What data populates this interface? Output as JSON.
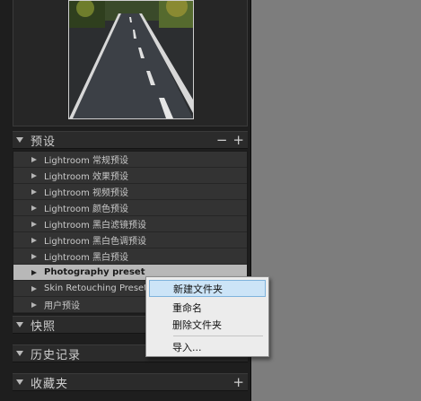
{
  "presets_panel": {
    "title": "预设",
    "minus_label": "−",
    "plus_label": "+",
    "items": [
      {
        "label": "Lightroom 常规预设"
      },
      {
        "label": "Lightroom 效果预设"
      },
      {
        "label": "Lightroom 视频预设"
      },
      {
        "label": "Lightroom 颜色预设"
      },
      {
        "label": "Lightroom 黑白滤镜预设"
      },
      {
        "label": "Lightroom 黑白色调预设"
      },
      {
        "label": "Lightroom 黑白预设"
      },
      {
        "label": "Photography preset",
        "selected": true
      },
      {
        "label": "Skin Retouching Preset"
      },
      {
        "label": "用户预设"
      }
    ]
  },
  "snapshots_panel": {
    "title": "快照"
  },
  "history_panel": {
    "title": "历史记录"
  },
  "collections_panel": {
    "title": "收藏夹",
    "plus_label": "+"
  },
  "context_menu": {
    "items": [
      "新建文件夹",
      "重命名",
      "删除文件夹",
      "导入..."
    ],
    "highlighted_index": 0
  },
  "thumbnail": {
    "icon": "road-photo-thumbnail"
  },
  "colors": {
    "panel_bg": "#1e1e1e",
    "preset_list_bg": "#333333",
    "selected_row": "#b8b8b8",
    "workspace_bg": "#7d7d7d",
    "menu_bg": "#ececec",
    "menu_highlight": "#cce4f7"
  }
}
